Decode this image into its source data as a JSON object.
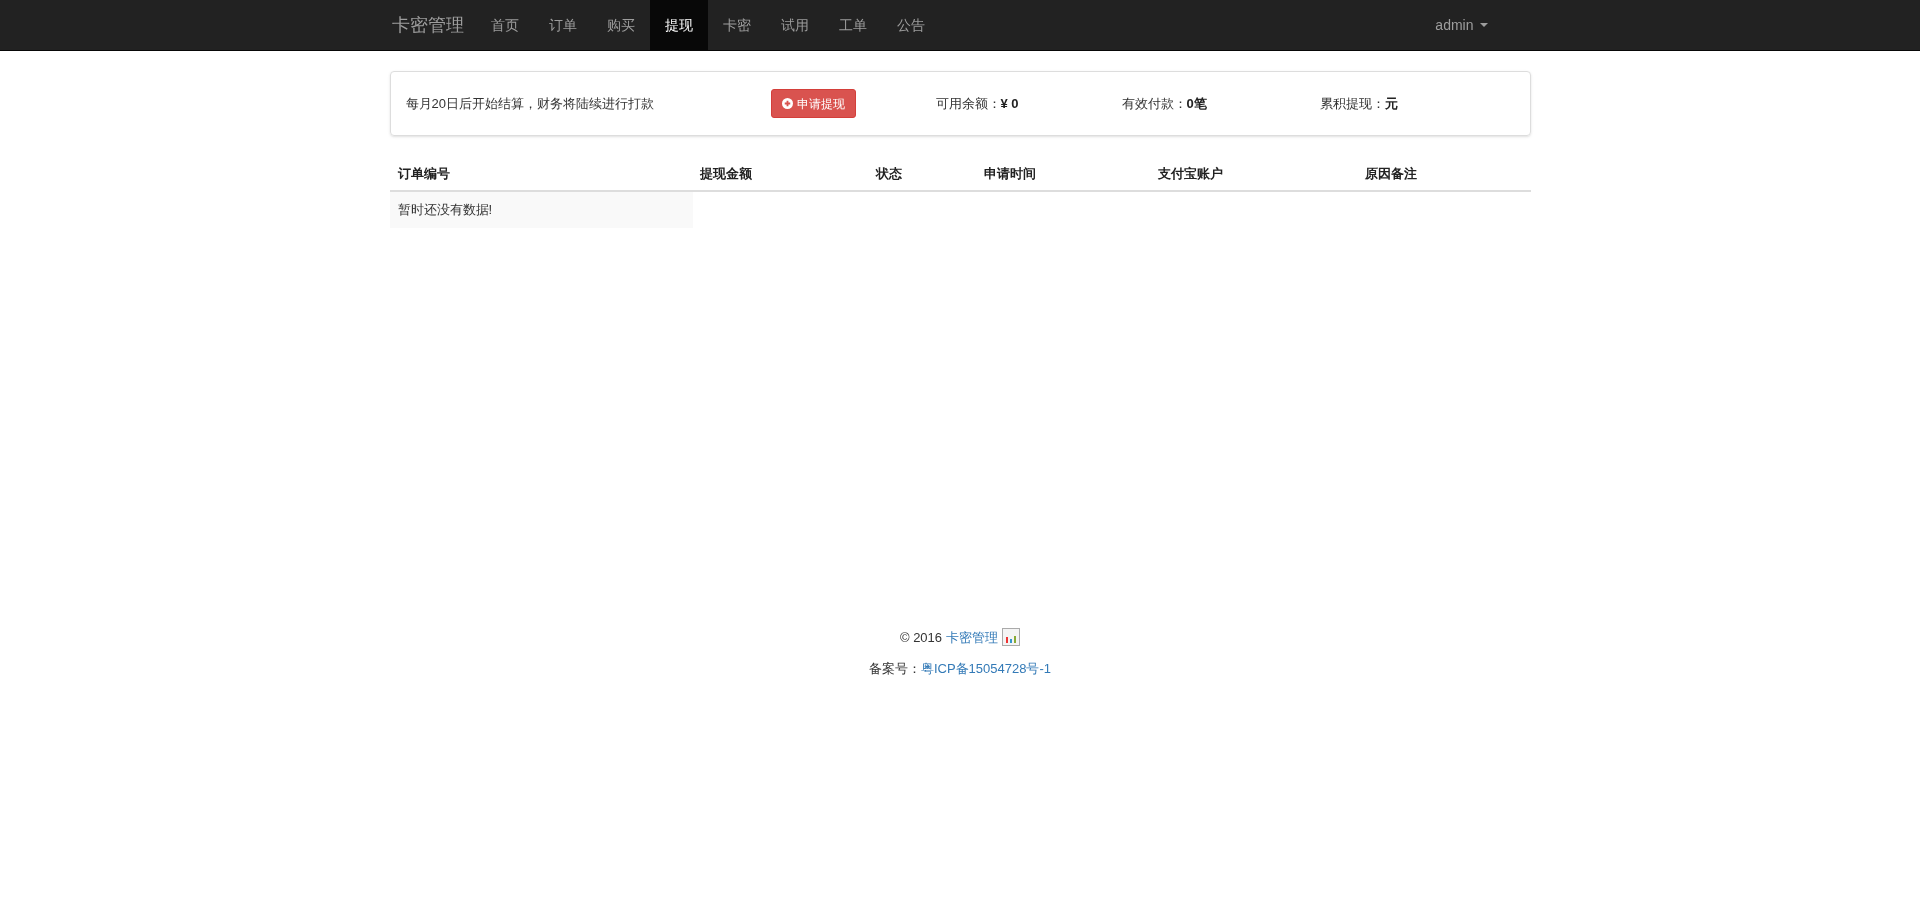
{
  "navbar": {
    "brand": "卡密管理",
    "items": [
      {
        "label": "首页",
        "selected": false
      },
      {
        "label": "订单",
        "selected": false
      },
      {
        "label": "购买",
        "selected": false
      },
      {
        "label": "提现",
        "selected": true
      },
      {
        "label": "卡密",
        "selected": false
      },
      {
        "label": "试用",
        "selected": false
      },
      {
        "label": "工单",
        "selected": false
      },
      {
        "label": "公告",
        "selected": false
      }
    ],
    "user": "admin"
  },
  "summary": {
    "notice": "每月20日后开始结算，财务将陆续进行打款",
    "apply_button": "申请提现",
    "stats": [
      {
        "label": "可用余额：",
        "value": "¥ 0"
      },
      {
        "label": "有效付款：",
        "value": "0笔"
      },
      {
        "label": "累积提现：",
        "value": "元"
      }
    ]
  },
  "table": {
    "columns": [
      "订单编号",
      "提现金额",
      "状态",
      "申请时间",
      "支付宝账户",
      "原因备注"
    ],
    "empty_message": "暂时还没有数据!"
  },
  "footer": {
    "copyright": "© 2016",
    "site_link": "卡密管理",
    "icp_label": "备案号：",
    "icp_link": "粤ICP备15054728号-1"
  }
}
